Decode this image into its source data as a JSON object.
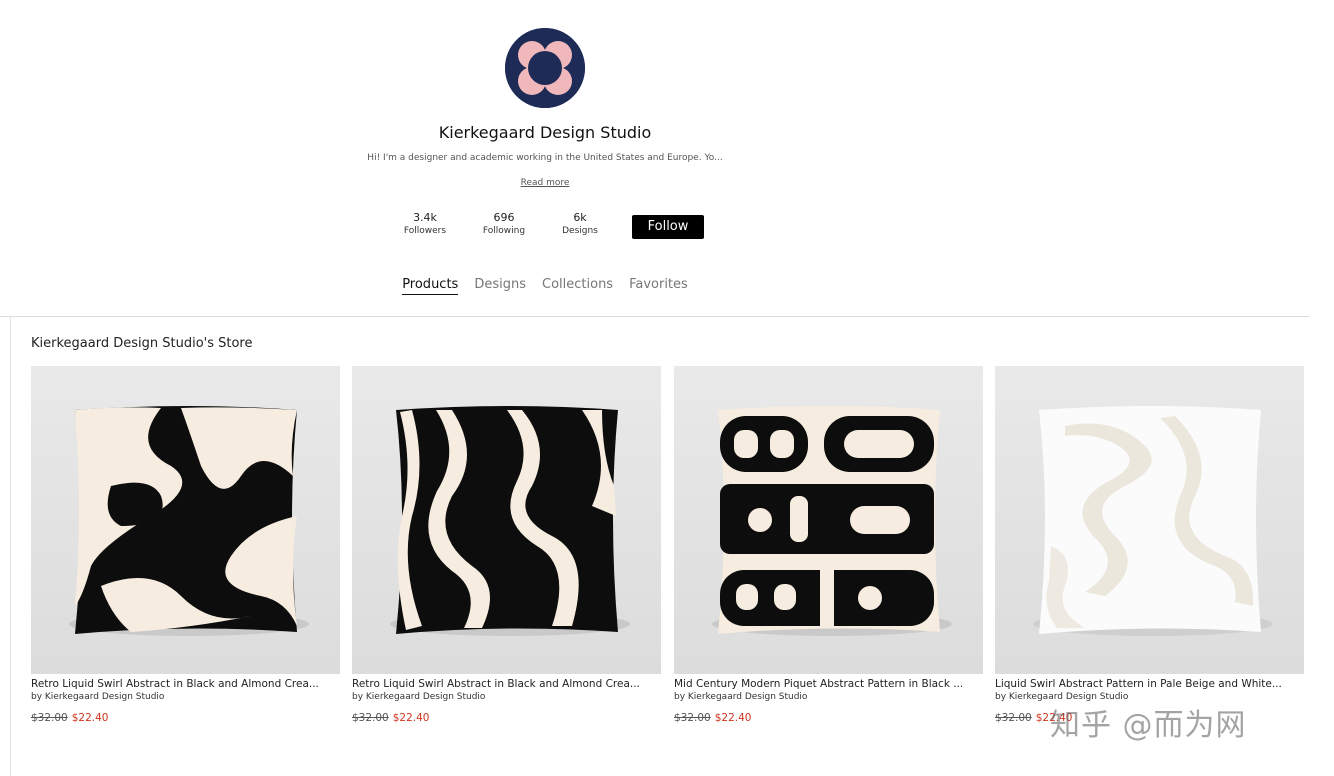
{
  "profile": {
    "name": "Kierkegaard Design Studio",
    "bio": "Hi! I'm a designer and academic working in the United States and Europe. Yo...",
    "read_more": "Read more",
    "avatar_colors": {
      "background": "#1e2b57",
      "petals": "#f0b8bb"
    }
  },
  "stats": [
    {
      "value": "3.4k",
      "label": "Followers"
    },
    {
      "value": "696",
      "label": "Following"
    },
    {
      "value": "6k",
      "label": "Designs"
    }
  ],
  "follow_label": "Follow",
  "tabs": [
    {
      "label": "Products",
      "active": true
    },
    {
      "label": "Designs",
      "active": false
    },
    {
      "label": "Collections",
      "active": false
    },
    {
      "label": "Favorites",
      "active": false
    }
  ],
  "section_title": "Kierkegaard Design Studio's Store",
  "products": [
    {
      "title": "Retro Liquid Swirl Abstract in Black and Almond Crea...",
      "by": "by Kierkegaard Design Studio",
      "old_price": "$32.00",
      "price": "$22.40",
      "pattern": "swirl-black"
    },
    {
      "title": "Retro Liquid Swirl Abstract in Black and Almond Crea...",
      "by": "by Kierkegaard Design Studio",
      "old_price": "$32.00",
      "price": "$22.40",
      "pattern": "swirl-black-2"
    },
    {
      "title": "Mid Century Modern Piquet Abstract Pattern in Black ...",
      "by": "by Kierkegaard Design Studio",
      "old_price": "$32.00",
      "price": "$22.40",
      "pattern": "piquet"
    },
    {
      "title": "Liquid Swirl Abstract Pattern in Pale Beige and White...",
      "by": "by Kierkegaard Design Studio",
      "old_price": "$32.00",
      "price": "$22.40",
      "pattern": "swirl-beige"
    }
  ],
  "watermark": "知乎 @而为网",
  "colors": {
    "sale": "#d0341b",
    "button": "#000000",
    "cream": "#f7ecdf",
    "ink": "#111111"
  }
}
